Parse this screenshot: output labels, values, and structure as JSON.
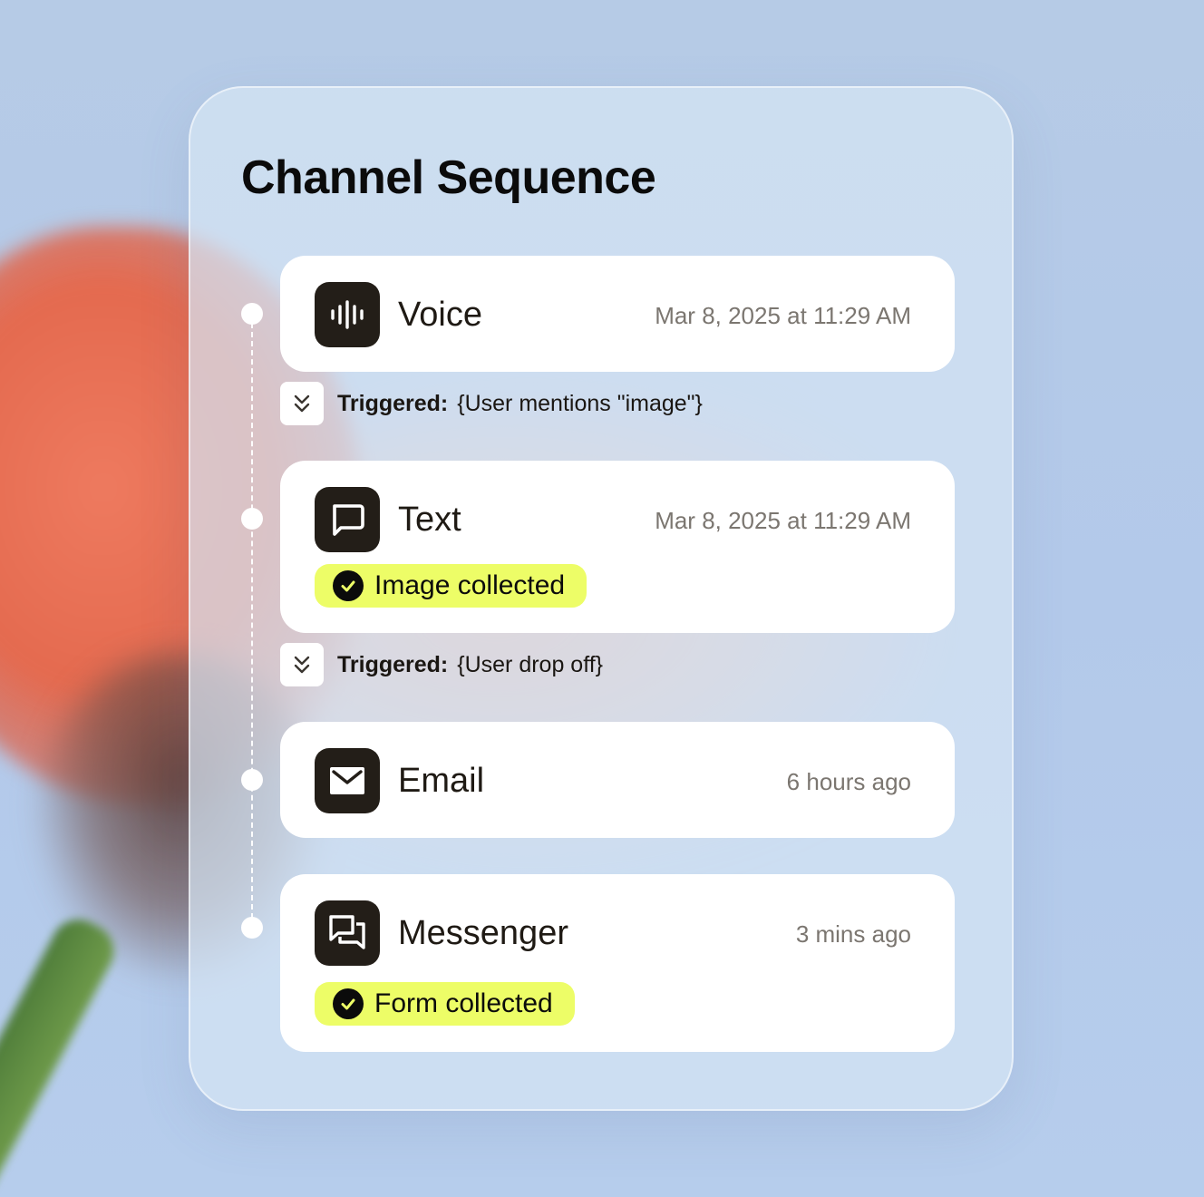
{
  "title": "Channel Sequence",
  "colors": {
    "icon_bg": "#231e18",
    "badge_bg": "#edfd67",
    "card_bg": "#ffffff",
    "time_text": "#7b7670"
  },
  "channels": [
    {
      "name": "Voice",
      "icon": "voice-waveform-icon",
      "time": "Mar 8, 2025 at 11:29 AM"
    },
    {
      "name": "Text",
      "icon": "chat-bubble-icon",
      "time": "Mar 8, 2025 at 11:29 AM",
      "badge": "Image collected"
    },
    {
      "name": "Email",
      "icon": "envelope-icon",
      "time": "6 hours ago"
    },
    {
      "name": "Messenger",
      "icon": "messenger-bubbles-icon",
      "time": "3 mins ago",
      "badge": "Form collected"
    }
  ],
  "triggers": [
    {
      "label": "Triggered:",
      "value": "{User mentions \"image\"}",
      "icon": "chevrons-down-icon"
    },
    {
      "label": "Triggered:",
      "value": "{User drop off}",
      "icon": "chevrons-down-icon"
    }
  ]
}
